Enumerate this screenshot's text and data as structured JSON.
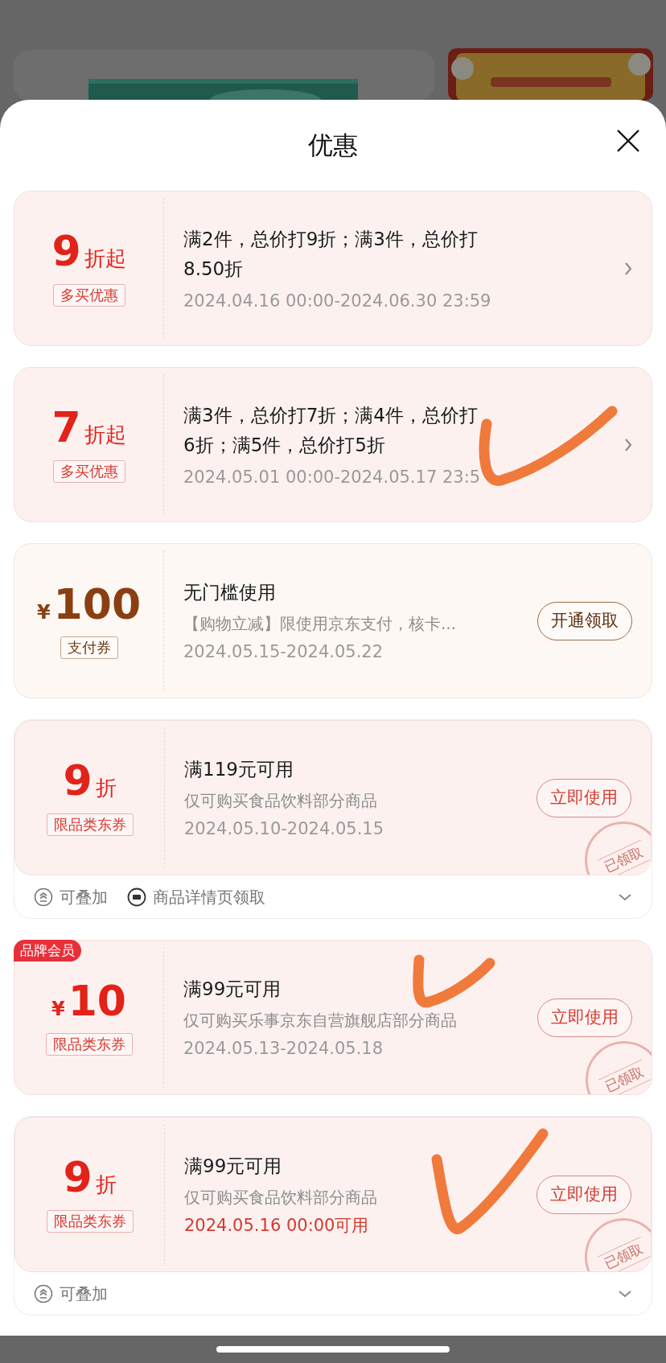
{
  "sheet": {
    "title": "优惠"
  },
  "coupons": [
    {
      "kind": "promo",
      "amount": {
        "kind": "discount",
        "value": "9",
        "unit": "折起"
      },
      "tag": "多买优惠",
      "title_lines": [
        "满2件，总价打9折；满3件，总价打",
        "8.50折"
      ],
      "date": "2024.04.16 00:00-2024.06.30 23:59",
      "date_highlight": false,
      "action": {
        "kind": "arrow"
      },
      "claimed": false,
      "hand_check": false
    },
    {
      "kind": "promo",
      "amount": {
        "kind": "discount",
        "value": "7",
        "unit": "折起"
      },
      "tag": "多买优惠",
      "title_lines": [
        "满3件，总价打7折；满4件，总价打",
        "6折；满5件，总价打5折"
      ],
      "date": "2024.05.01 00:00-2024.05.17 23:5",
      "date_highlight": false,
      "action": {
        "kind": "arrow"
      },
      "claimed": false,
      "hand_check": true
    },
    {
      "kind": "payment",
      "amount": {
        "kind": "cash",
        "currency": "¥",
        "value": "100"
      },
      "tag": "支付券",
      "title_lines": [
        "无门槛使用"
      ],
      "subtitle": "【购物立减】限使用京东支付，核卡...",
      "date": "2024.05.15-2024.05.22",
      "date_highlight": false,
      "action": {
        "kind": "button",
        "label": "开通领取"
      },
      "claimed": false,
      "hand_check": false
    },
    {
      "kind": "promo",
      "amount": {
        "kind": "discount",
        "value": "9",
        "unit": "折"
      },
      "tag": "限品类东券",
      "title_lines": [
        "满119元可用"
      ],
      "subtitle": "仅可购买食品饮料部分商品",
      "date": "2024.05.10-2024.05.15",
      "date_highlight": false,
      "action": {
        "kind": "button",
        "label": "立即使用"
      },
      "claimed": true,
      "stamp": "已领取",
      "hand_check": false,
      "footer": {
        "items": [
          {
            "kind": "stack",
            "label": "可叠加"
          },
          {
            "kind": "detail",
            "label": "商品详情页领取"
          }
        ]
      }
    },
    {
      "kind": "promo",
      "badge": "品牌会员",
      "amount": {
        "kind": "cash",
        "currency": "¥",
        "value": "10"
      },
      "tag": "限品类东券",
      "title_lines": [
        "满99元可用"
      ],
      "subtitle": "仅可购买乐事京东自营旗舰店部分商品",
      "date": "2024.05.13-2024.05.18",
      "date_highlight": false,
      "action": {
        "kind": "button",
        "label": "立即使用"
      },
      "claimed": true,
      "stamp": "已领取",
      "hand_check": true
    },
    {
      "kind": "promo",
      "amount": {
        "kind": "discount",
        "value": "9",
        "unit": "折"
      },
      "tag": "限品类东券",
      "title_lines": [
        "满99元可用"
      ],
      "subtitle": "仅可购买食品饮料部分商品",
      "date": "2024.05.16 00:00可用",
      "date_highlight": true,
      "action": {
        "kind": "button",
        "label": "立即使用"
      },
      "claimed": true,
      "stamp": "已领取",
      "hand_check": true,
      "footer": {
        "items": [
          {
            "kind": "stack",
            "label": "可叠加"
          }
        ]
      }
    }
  ]
}
